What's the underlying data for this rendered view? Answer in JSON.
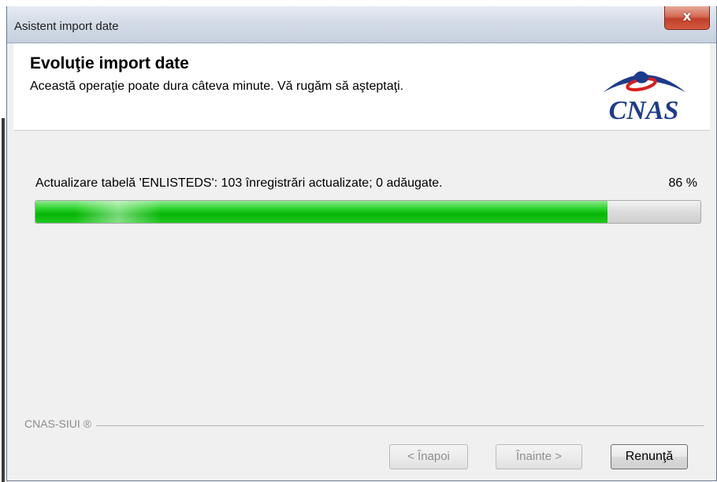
{
  "window": {
    "title": "Asistent import date",
    "close_glyph": "x"
  },
  "header": {
    "heading": "Evoluţie import date",
    "subheading": "Această operaţie poate dura câteva minute. Vă rugăm să aşteptaţi.",
    "logo_text": "CNAS",
    "logo_color": "#1d3b8c",
    "logo_accent_color": "#d81e1e"
  },
  "progress": {
    "status": "Actualizare tabelă 'ENLISTEDS': 103 înregistrări actualizate; 0 adăugate.",
    "percent_label": "86 %",
    "fraction": 0.86,
    "fill_color": "#10bd10"
  },
  "footer": {
    "brand_label": "CNAS-SIUI ®"
  },
  "buttons": {
    "back_label": "< Înapoi",
    "next_label": "Înainte >",
    "cancel_label": "Renunţă"
  }
}
